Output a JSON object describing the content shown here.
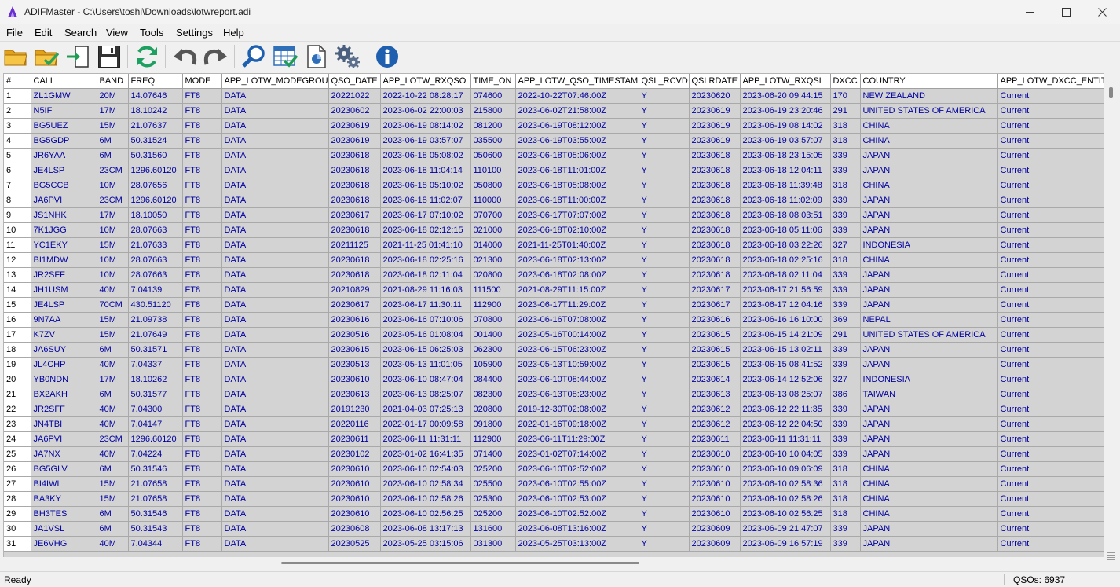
{
  "window": {
    "title": "ADIFMaster - C:\\Users\\toshi\\Downloads\\lotwreport.adi"
  },
  "menu": [
    "File",
    "Edit",
    "Search",
    "View",
    "Tools",
    "Settings",
    "Help"
  ],
  "toolbar": {
    "icons": [
      "open-folder-icon",
      "open-checked-folder-icon",
      "import-icon",
      "save-icon",
      "refresh-icon",
      "undo-icon",
      "redo-icon",
      "search-icon",
      "table-check-icon",
      "document-icon",
      "settings-gears-icon",
      "info-icon"
    ]
  },
  "table": {
    "columns": [
      "#",
      "CALL",
      "BAND",
      "FREQ",
      "MODE",
      "APP_LOTW_MODEGROUP",
      "QSO_DATE",
      "APP_LOTW_RXQSO",
      "TIME_ON",
      "APP_LOTW_QSO_TIMESTAMP",
      "QSL_RCVD",
      "QSLRDATE",
      "APP_LOTW_RXQSL",
      "DXCC",
      "COUNTRY",
      "APP_LOTW_DXCC_ENTITY_"
    ],
    "rows": [
      [
        "1",
        "ZL1GMW",
        "20M",
        "14.07646",
        "FT8",
        "DATA",
        "20221022",
        "2022-10-22 08:28:17",
        "074600",
        "2022-10-22T07:46:00Z",
        "Y",
        "20230620",
        "2023-06-20 09:44:15",
        "170",
        "NEW ZEALAND",
        "Current"
      ],
      [
        "2",
        "N5IF",
        "17M",
        "18.10242",
        "FT8",
        "DATA",
        "20230602",
        "2023-06-02 22:00:03",
        "215800",
        "2023-06-02T21:58:00Z",
        "Y",
        "20230619",
        "2023-06-19 23:20:46",
        "291",
        "UNITED STATES OF AMERICA",
        "Current"
      ],
      [
        "3",
        "BG5UEZ",
        "15M",
        "21.07637",
        "FT8",
        "DATA",
        "20230619",
        "2023-06-19 08:14:02",
        "081200",
        "2023-06-19T08:12:00Z",
        "Y",
        "20230619",
        "2023-06-19 08:14:02",
        "318",
        "CHINA",
        "Current"
      ],
      [
        "4",
        "BG5GDP",
        "6M",
        "50.31524",
        "FT8",
        "DATA",
        "20230619",
        "2023-06-19 03:57:07",
        "035500",
        "2023-06-19T03:55:00Z",
        "Y",
        "20230619",
        "2023-06-19 03:57:07",
        "318",
        "CHINA",
        "Current"
      ],
      [
        "5",
        "JR6YAA",
        "6M",
        "50.31560",
        "FT8",
        "DATA",
        "20230618",
        "2023-06-18 05:08:02",
        "050600",
        "2023-06-18T05:06:00Z",
        "Y",
        "20230618",
        "2023-06-18 23:15:05",
        "339",
        "JAPAN",
        "Current"
      ],
      [
        "6",
        "JE4LSP",
        "23CM",
        "1296.60120",
        "FT8",
        "DATA",
        "20230618",
        "2023-06-18 11:04:14",
        "110100",
        "2023-06-18T11:01:00Z",
        "Y",
        "20230618",
        "2023-06-18 12:04:11",
        "339",
        "JAPAN",
        "Current"
      ],
      [
        "7",
        "BG5CCB",
        "10M",
        "28.07656",
        "FT8",
        "DATA",
        "20230618",
        "2023-06-18 05:10:02",
        "050800",
        "2023-06-18T05:08:00Z",
        "Y",
        "20230618",
        "2023-06-18 11:39:48",
        "318",
        "CHINA",
        "Current"
      ],
      [
        "8",
        "JA6PVI",
        "23CM",
        "1296.60120",
        "FT8",
        "DATA",
        "20230618",
        "2023-06-18 11:02:07",
        "110000",
        "2023-06-18T11:00:00Z",
        "Y",
        "20230618",
        "2023-06-18 11:02:09",
        "339",
        "JAPAN",
        "Current"
      ],
      [
        "9",
        "JS1NHK",
        "17M",
        "18.10050",
        "FT8",
        "DATA",
        "20230617",
        "2023-06-17 07:10:02",
        "070700",
        "2023-06-17T07:07:00Z",
        "Y",
        "20230618",
        "2023-06-18 08:03:51",
        "339",
        "JAPAN",
        "Current"
      ],
      [
        "10",
        "7K1JGG",
        "10M",
        "28.07663",
        "FT8",
        "DATA",
        "20230618",
        "2023-06-18 02:12:15",
        "021000",
        "2023-06-18T02:10:00Z",
        "Y",
        "20230618",
        "2023-06-18 05:11:06",
        "339",
        "JAPAN",
        "Current"
      ],
      [
        "11",
        "YC1EKY",
        "15M",
        "21.07633",
        "FT8",
        "DATA",
        "20211125",
        "2021-11-25 01:41:10",
        "014000",
        "2021-11-25T01:40:00Z",
        "Y",
        "20230618",
        "2023-06-18 03:22:26",
        "327",
        "INDONESIA",
        "Current"
      ],
      [
        "12",
        "BI1MDW",
        "10M",
        "28.07663",
        "FT8",
        "DATA",
        "20230618",
        "2023-06-18 02:25:16",
        "021300",
        "2023-06-18T02:13:00Z",
        "Y",
        "20230618",
        "2023-06-18 02:25:16",
        "318",
        "CHINA",
        "Current"
      ],
      [
        "13",
        "JR2SFF",
        "10M",
        "28.07663",
        "FT8",
        "DATA",
        "20230618",
        "2023-06-18 02:11:04",
        "020800",
        "2023-06-18T02:08:00Z",
        "Y",
        "20230618",
        "2023-06-18 02:11:04",
        "339",
        "JAPAN",
        "Current"
      ],
      [
        "14",
        "JH1USM",
        "40M",
        "7.04139",
        "FT8",
        "DATA",
        "20210829",
        "2021-08-29 11:16:03",
        "111500",
        "2021-08-29T11:15:00Z",
        "Y",
        "20230617",
        "2023-06-17 21:56:59",
        "339",
        "JAPAN",
        "Current"
      ],
      [
        "15",
        "JE4LSP",
        "70CM",
        "430.51120",
        "FT8",
        "DATA",
        "20230617",
        "2023-06-17 11:30:11",
        "112900",
        "2023-06-17T11:29:00Z",
        "Y",
        "20230617",
        "2023-06-17 12:04:16",
        "339",
        "JAPAN",
        "Current"
      ],
      [
        "16",
        "9N7AA",
        "15M",
        "21.09738",
        "FT8",
        "DATA",
        "20230616",
        "2023-06-16 07:10:06",
        "070800",
        "2023-06-16T07:08:00Z",
        "Y",
        "20230616",
        "2023-06-16 16:10:00",
        "369",
        "NEPAL",
        "Current"
      ],
      [
        "17",
        "K7ZV",
        "15M",
        "21.07649",
        "FT8",
        "DATA",
        "20230516",
        "2023-05-16 01:08:04",
        "001400",
        "2023-05-16T00:14:00Z",
        "Y",
        "20230615",
        "2023-06-15 14:21:09",
        "291",
        "UNITED STATES OF AMERICA",
        "Current"
      ],
      [
        "18",
        "JA6SUY",
        "6M",
        "50.31571",
        "FT8",
        "DATA",
        "20230615",
        "2023-06-15 06:25:03",
        "062300",
        "2023-06-15T06:23:00Z",
        "Y",
        "20230615",
        "2023-06-15 13:02:11",
        "339",
        "JAPAN",
        "Current"
      ],
      [
        "19",
        "JL4CHP",
        "40M",
        "7.04337",
        "FT8",
        "DATA",
        "20230513",
        "2023-05-13 11:01:05",
        "105900",
        "2023-05-13T10:59:00Z",
        "Y",
        "20230615",
        "2023-06-15 08:41:52",
        "339",
        "JAPAN",
        "Current"
      ],
      [
        "20",
        "YB0NDN",
        "17M",
        "18.10262",
        "FT8",
        "DATA",
        "20230610",
        "2023-06-10 08:47:04",
        "084400",
        "2023-06-10T08:44:00Z",
        "Y",
        "20230614",
        "2023-06-14 12:52:06",
        "327",
        "INDONESIA",
        "Current"
      ],
      [
        "21",
        "BX2AKH",
        "6M",
        "50.31577",
        "FT8",
        "DATA",
        "20230613",
        "2023-06-13 08:25:07",
        "082300",
        "2023-06-13T08:23:00Z",
        "Y",
        "20230613",
        "2023-06-13 08:25:07",
        "386",
        "TAIWAN",
        "Current"
      ],
      [
        "22",
        "JR2SFF",
        "40M",
        "7.04300",
        "FT8",
        "DATA",
        "20191230",
        "2021-04-03 07:25:13",
        "020800",
        "2019-12-30T02:08:00Z",
        "Y",
        "20230612",
        "2023-06-12 22:11:35",
        "339",
        "JAPAN",
        "Current"
      ],
      [
        "23",
        "JN4TBI",
        "40M",
        "7.04147",
        "FT8",
        "DATA",
        "20220116",
        "2022-01-17 00:09:58",
        "091800",
        "2022-01-16T09:18:00Z",
        "Y",
        "20230612",
        "2023-06-12 22:04:50",
        "339",
        "JAPAN",
        "Current"
      ],
      [
        "24",
        "JA6PVI",
        "23CM",
        "1296.60120",
        "FT8",
        "DATA",
        "20230611",
        "2023-06-11 11:31:11",
        "112900",
        "2023-06-11T11:29:00Z",
        "Y",
        "20230611",
        "2023-06-11 11:31:11",
        "339",
        "JAPAN",
        "Current"
      ],
      [
        "25",
        "JA7NX",
        "40M",
        "7.04224",
        "FT8",
        "DATA",
        "20230102",
        "2023-01-02 16:41:35",
        "071400",
        "2023-01-02T07:14:00Z",
        "Y",
        "20230610",
        "2023-06-10 10:04:05",
        "339",
        "JAPAN",
        "Current"
      ],
      [
        "26",
        "BG5GLV",
        "6M",
        "50.31546",
        "FT8",
        "DATA",
        "20230610",
        "2023-06-10 02:54:03",
        "025200",
        "2023-06-10T02:52:00Z",
        "Y",
        "20230610",
        "2023-06-10 09:06:09",
        "318",
        "CHINA",
        "Current"
      ],
      [
        "27",
        "BI4IWL",
        "15M",
        "21.07658",
        "FT8",
        "DATA",
        "20230610",
        "2023-06-10 02:58:34",
        "025500",
        "2023-06-10T02:55:00Z",
        "Y",
        "20230610",
        "2023-06-10 02:58:36",
        "318",
        "CHINA",
        "Current"
      ],
      [
        "28",
        "BA3KY",
        "15M",
        "21.07658",
        "FT8",
        "DATA",
        "20230610",
        "2023-06-10 02:58:26",
        "025300",
        "2023-06-10T02:53:00Z",
        "Y",
        "20230610",
        "2023-06-10 02:58:26",
        "318",
        "CHINA",
        "Current"
      ],
      [
        "29",
        "BH3TES",
        "6M",
        "50.31546",
        "FT8",
        "DATA",
        "20230610",
        "2023-06-10 02:56:25",
        "025200",
        "2023-06-10T02:52:00Z",
        "Y",
        "20230610",
        "2023-06-10 02:56:25",
        "318",
        "CHINA",
        "Current"
      ],
      [
        "30",
        "JA1VSL",
        "6M",
        "50.31543",
        "FT8",
        "DATA",
        "20230608",
        "2023-06-08 13:17:13",
        "131600",
        "2023-06-08T13:16:00Z",
        "Y",
        "20230609",
        "2023-06-09 21:47:07",
        "339",
        "JAPAN",
        "Current"
      ],
      [
        "31",
        "JE6VHG",
        "40M",
        "7.04344",
        "FT8",
        "DATA",
        "20230525",
        "2023-05-25 03:15:06",
        "031300",
        "2023-05-25T03:13:00Z",
        "Y",
        "20230609",
        "2023-06-09 16:57:19",
        "339",
        "JAPAN",
        "Current"
      ]
    ]
  },
  "status": {
    "left": "Ready",
    "right": "QSOs: 6937"
  }
}
